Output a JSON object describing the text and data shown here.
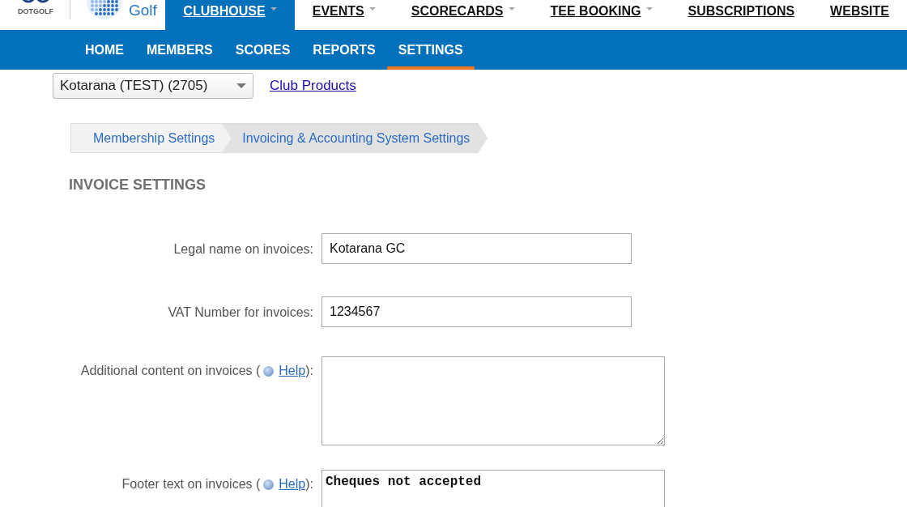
{
  "header": {
    "logo_text": "DOTGOLF",
    "brand": "Golf",
    "nav": [
      {
        "label": "CLUBHOUSE",
        "selected": true,
        "dropdown": true
      },
      {
        "label": "EVENTS",
        "selected": false,
        "dropdown": true
      },
      {
        "label": "SCORECARDS",
        "selected": false,
        "dropdown": true
      },
      {
        "label": "TEE BOOKING",
        "selected": false,
        "dropdown": true
      },
      {
        "label": "SUBSCRIPTIONS",
        "selected": false,
        "dropdown": false
      },
      {
        "label": "WEBSITE",
        "selected": false,
        "dropdown": false
      }
    ]
  },
  "subnav": [
    {
      "label": "HOME",
      "selected": false
    },
    {
      "label": "MEMBERS",
      "selected": false
    },
    {
      "label": "SCORES",
      "selected": false
    },
    {
      "label": "REPORTS",
      "selected": false
    },
    {
      "label": "SETTINGS",
      "selected": true
    }
  ],
  "club_select": {
    "value": "Kotarana (TEST) (2705)"
  },
  "club_link": "Club Products",
  "breadcrumb": [
    {
      "label": "Membership Settings",
      "selected": false
    },
    {
      "label": "Invoicing & Accounting System Settings",
      "selected": true
    }
  ],
  "section_title": "INVOICE SETTINGS",
  "fields": [
    {
      "kind": "input",
      "label": "Legal name on invoices:",
      "value": "Kotarana GC"
    },
    {
      "kind": "input",
      "label": "VAT Number for invoices:",
      "value": "1234567"
    },
    {
      "kind": "textarea",
      "label": "Additional content on invoices (",
      "help": "Help",
      "label_end": "):"
    },
    {
      "kind": "textarea_mono",
      "label": "Footer text on invoices (",
      "help": "Help",
      "label_end": "):",
      "value": "Cheques not accepted"
    }
  ]
}
